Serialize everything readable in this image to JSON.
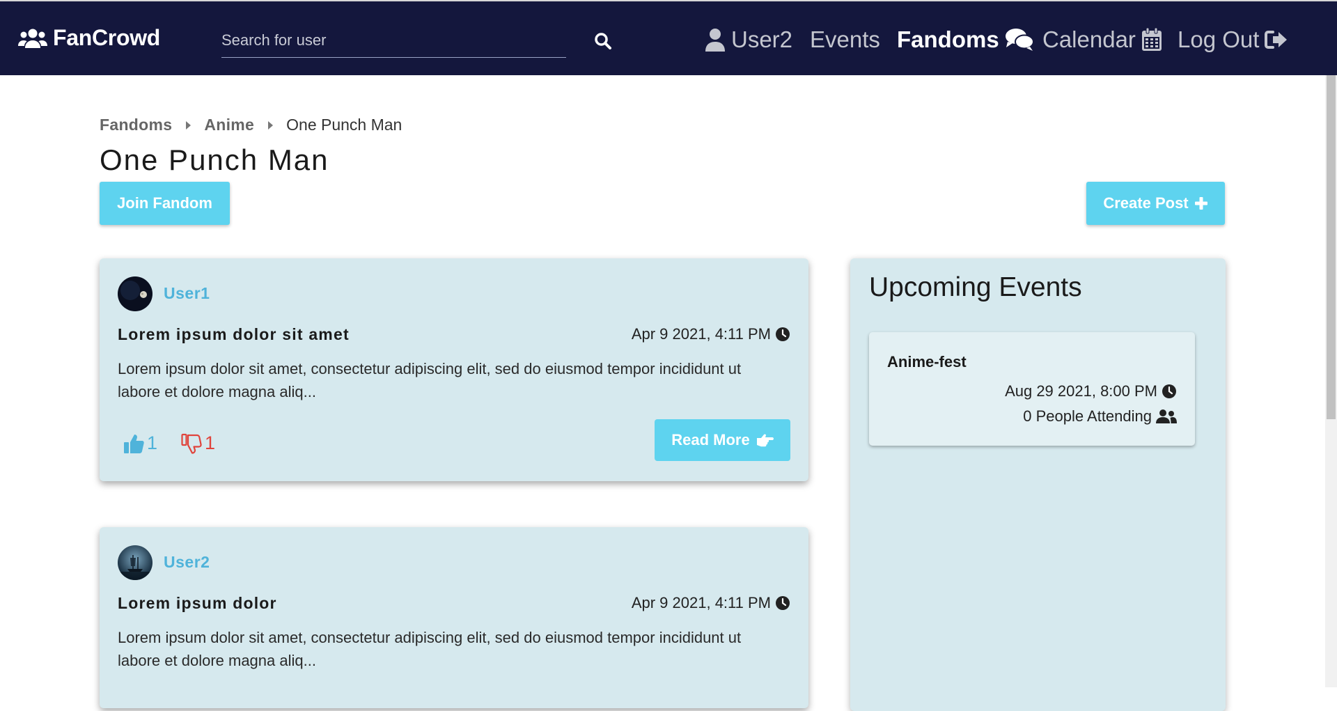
{
  "nav": {
    "brand": "FanCrowd",
    "search_placeholder": "Search for user",
    "items": [
      {
        "label": "User2",
        "icon": "user-icon"
      },
      {
        "label": "Events",
        "icon": ""
      },
      {
        "label": "Fandoms",
        "icon": "comments-icon",
        "active": true
      },
      {
        "label": "Calendar",
        "icon": "calendar-icon"
      },
      {
        "label": "Log Out",
        "icon": "logout-icon"
      }
    ]
  },
  "breadcrumb": [
    {
      "label": "Fandoms",
      "link": true
    },
    {
      "label": "Anime",
      "link": true
    },
    {
      "label": "One Punch Man",
      "link": false
    }
  ],
  "page_title": "One Punch Man",
  "buttons": {
    "join": "Join Fandom",
    "create_post": "Create Post"
  },
  "posts": [
    {
      "user": "User1",
      "title": "Lorem ipsum dolor sit amet",
      "date": "Apr 9 2021, 4:11 PM",
      "body": "Lorem ipsum dolor sit amet, consectetur adipiscing elit, sed do eiusmod tempor incididunt ut labore et dolore magna aliq...",
      "likes": "1",
      "dislikes": "1",
      "read_more": "Read More"
    },
    {
      "user": "User2",
      "title": "Lorem ipsum dolor",
      "date": "Apr 9 2021, 4:11 PM",
      "body": "Lorem ipsum dolor sit amet, consectetur adipiscing elit, sed do eiusmod tempor incididunt ut labore et dolore magna aliq..."
    }
  ],
  "events": {
    "heading": "Upcoming Events",
    "items": [
      {
        "name": "Anime-fest",
        "date": "Aug 29 2021, 8:00 PM",
        "attending": "0 People Attending"
      }
    ]
  },
  "colors": {
    "navbar": "#14173d",
    "accent": "#5ed3ef",
    "card": "#d6e9ee",
    "username": "#4fb3da",
    "dislike": "#e0443c"
  }
}
